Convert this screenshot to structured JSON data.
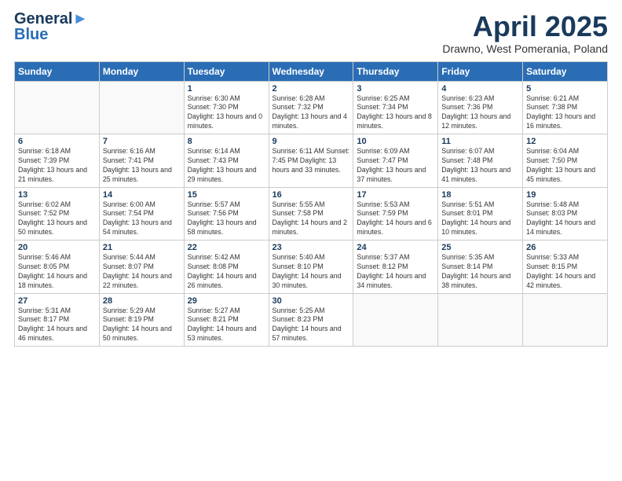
{
  "logo": {
    "line1": "General",
    "line2": "Blue",
    "tagline": "Blue"
  },
  "title": "April 2025",
  "subtitle": "Drawno, West Pomerania, Poland",
  "days_of_week": [
    "Sunday",
    "Monday",
    "Tuesday",
    "Wednesday",
    "Thursday",
    "Friday",
    "Saturday"
  ],
  "weeks": [
    [
      {
        "day": "",
        "info": ""
      },
      {
        "day": "",
        "info": ""
      },
      {
        "day": "1",
        "info": "Sunrise: 6:30 AM\nSunset: 7:30 PM\nDaylight: 13 hours and 0 minutes."
      },
      {
        "day": "2",
        "info": "Sunrise: 6:28 AM\nSunset: 7:32 PM\nDaylight: 13 hours and 4 minutes."
      },
      {
        "day": "3",
        "info": "Sunrise: 6:25 AM\nSunset: 7:34 PM\nDaylight: 13 hours and 8 minutes."
      },
      {
        "day": "4",
        "info": "Sunrise: 6:23 AM\nSunset: 7:36 PM\nDaylight: 13 hours and 12 minutes."
      },
      {
        "day": "5",
        "info": "Sunrise: 6:21 AM\nSunset: 7:38 PM\nDaylight: 13 hours and 16 minutes."
      }
    ],
    [
      {
        "day": "6",
        "info": "Sunrise: 6:18 AM\nSunset: 7:39 PM\nDaylight: 13 hours and 21 minutes."
      },
      {
        "day": "7",
        "info": "Sunrise: 6:16 AM\nSunset: 7:41 PM\nDaylight: 13 hours and 25 minutes."
      },
      {
        "day": "8",
        "info": "Sunrise: 6:14 AM\nSunset: 7:43 PM\nDaylight: 13 hours and 29 minutes."
      },
      {
        "day": "9",
        "info": "Sunrise: 6:11 AM\nSunset: 7:45 PM\nDaylight: 13 hours and 33 minutes."
      },
      {
        "day": "10",
        "info": "Sunrise: 6:09 AM\nSunset: 7:47 PM\nDaylight: 13 hours and 37 minutes."
      },
      {
        "day": "11",
        "info": "Sunrise: 6:07 AM\nSunset: 7:48 PM\nDaylight: 13 hours and 41 minutes."
      },
      {
        "day": "12",
        "info": "Sunrise: 6:04 AM\nSunset: 7:50 PM\nDaylight: 13 hours and 45 minutes."
      }
    ],
    [
      {
        "day": "13",
        "info": "Sunrise: 6:02 AM\nSunset: 7:52 PM\nDaylight: 13 hours and 50 minutes."
      },
      {
        "day": "14",
        "info": "Sunrise: 6:00 AM\nSunset: 7:54 PM\nDaylight: 13 hours and 54 minutes."
      },
      {
        "day": "15",
        "info": "Sunrise: 5:57 AM\nSunset: 7:56 PM\nDaylight: 13 hours and 58 minutes."
      },
      {
        "day": "16",
        "info": "Sunrise: 5:55 AM\nSunset: 7:58 PM\nDaylight: 14 hours and 2 minutes."
      },
      {
        "day": "17",
        "info": "Sunrise: 5:53 AM\nSunset: 7:59 PM\nDaylight: 14 hours and 6 minutes."
      },
      {
        "day": "18",
        "info": "Sunrise: 5:51 AM\nSunset: 8:01 PM\nDaylight: 14 hours and 10 minutes."
      },
      {
        "day": "19",
        "info": "Sunrise: 5:48 AM\nSunset: 8:03 PM\nDaylight: 14 hours and 14 minutes."
      }
    ],
    [
      {
        "day": "20",
        "info": "Sunrise: 5:46 AM\nSunset: 8:05 PM\nDaylight: 14 hours and 18 minutes."
      },
      {
        "day": "21",
        "info": "Sunrise: 5:44 AM\nSunset: 8:07 PM\nDaylight: 14 hours and 22 minutes."
      },
      {
        "day": "22",
        "info": "Sunrise: 5:42 AM\nSunset: 8:08 PM\nDaylight: 14 hours and 26 minutes."
      },
      {
        "day": "23",
        "info": "Sunrise: 5:40 AM\nSunset: 8:10 PM\nDaylight: 14 hours and 30 minutes."
      },
      {
        "day": "24",
        "info": "Sunrise: 5:37 AM\nSunset: 8:12 PM\nDaylight: 14 hours and 34 minutes."
      },
      {
        "day": "25",
        "info": "Sunrise: 5:35 AM\nSunset: 8:14 PM\nDaylight: 14 hours and 38 minutes."
      },
      {
        "day": "26",
        "info": "Sunrise: 5:33 AM\nSunset: 8:15 PM\nDaylight: 14 hours and 42 minutes."
      }
    ],
    [
      {
        "day": "27",
        "info": "Sunrise: 5:31 AM\nSunset: 8:17 PM\nDaylight: 14 hours and 46 minutes."
      },
      {
        "day": "28",
        "info": "Sunrise: 5:29 AM\nSunset: 8:19 PM\nDaylight: 14 hours and 50 minutes."
      },
      {
        "day": "29",
        "info": "Sunrise: 5:27 AM\nSunset: 8:21 PM\nDaylight: 14 hours and 53 minutes."
      },
      {
        "day": "30",
        "info": "Sunrise: 5:25 AM\nSunset: 8:23 PM\nDaylight: 14 hours and 57 minutes."
      },
      {
        "day": "",
        "info": ""
      },
      {
        "day": "",
        "info": ""
      },
      {
        "day": "",
        "info": ""
      }
    ]
  ]
}
